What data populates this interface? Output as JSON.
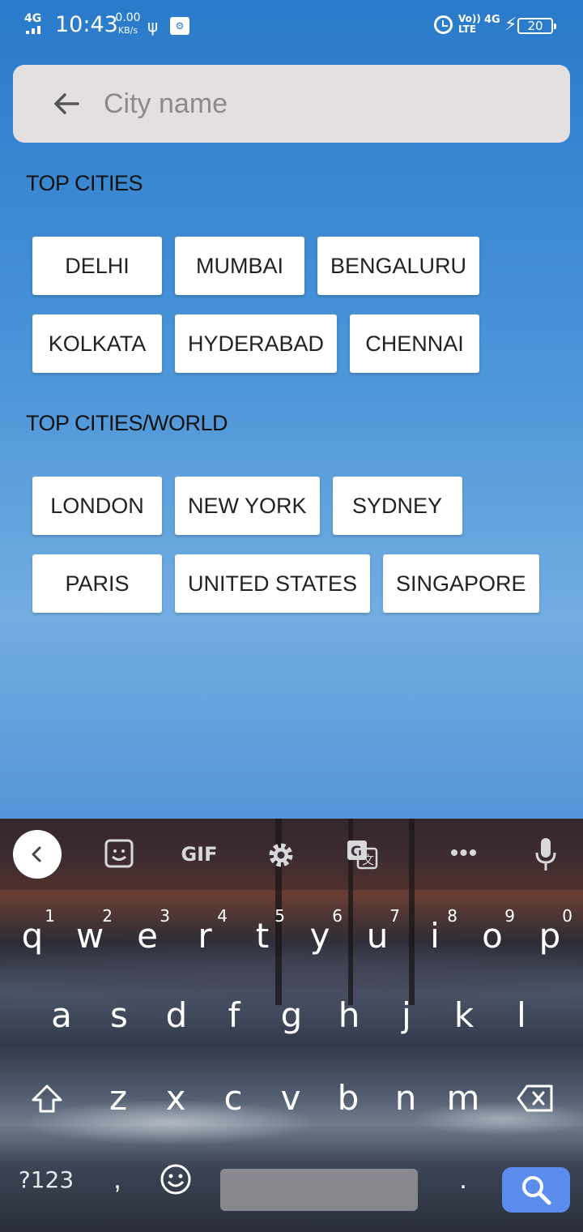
{
  "status_bar": {
    "network": "4G",
    "time": "10:43",
    "speed_value": "0.00",
    "speed_unit": "KB/s",
    "volte_top": "Vo))",
    "volte_bottom": "LTE",
    "signal_type": "4G",
    "battery": "20"
  },
  "search": {
    "placeholder": "City name",
    "value": ""
  },
  "sections": [
    {
      "title": "TOP CITIES",
      "rows": [
        [
          "DELHI",
          "MUMBAI",
          "BENGALURU"
        ],
        [
          "KOLKATA",
          "HYDERABAD",
          "CHENNAI"
        ]
      ]
    },
    {
      "title": "TOP CITIES/WORLD",
      "rows": [
        [
          "LONDON",
          "NEW YORK",
          "SYDNEY"
        ],
        [
          "PARIS",
          "UNITED STATES",
          "SINGAPORE"
        ]
      ]
    }
  ],
  "keyboard": {
    "toolbar_gif": "GIF",
    "more": "•••",
    "row1": [
      {
        "k": "q",
        "n": "1"
      },
      {
        "k": "w",
        "n": "2"
      },
      {
        "k": "e",
        "n": "3"
      },
      {
        "k": "r",
        "n": "4"
      },
      {
        "k": "t",
        "n": "5"
      },
      {
        "k": "y",
        "n": "6"
      },
      {
        "k": "u",
        "n": "7"
      },
      {
        "k": "i",
        "n": "8"
      },
      {
        "k": "o",
        "n": "9"
      },
      {
        "k": "p",
        "n": "0"
      }
    ],
    "row2": [
      "a",
      "s",
      "d",
      "f",
      "g",
      "h",
      "j",
      "k",
      "l"
    ],
    "row3": [
      "z",
      "x",
      "c",
      "v",
      "b",
      "n",
      "m"
    ],
    "symbols_label": "?123",
    "comma": ",",
    "period": "."
  },
  "colors": {
    "background_top": "#2a7acb",
    "chip_background": "#ffffff",
    "search_bar": "#e5e0e0",
    "search_key": "#5b8def"
  }
}
